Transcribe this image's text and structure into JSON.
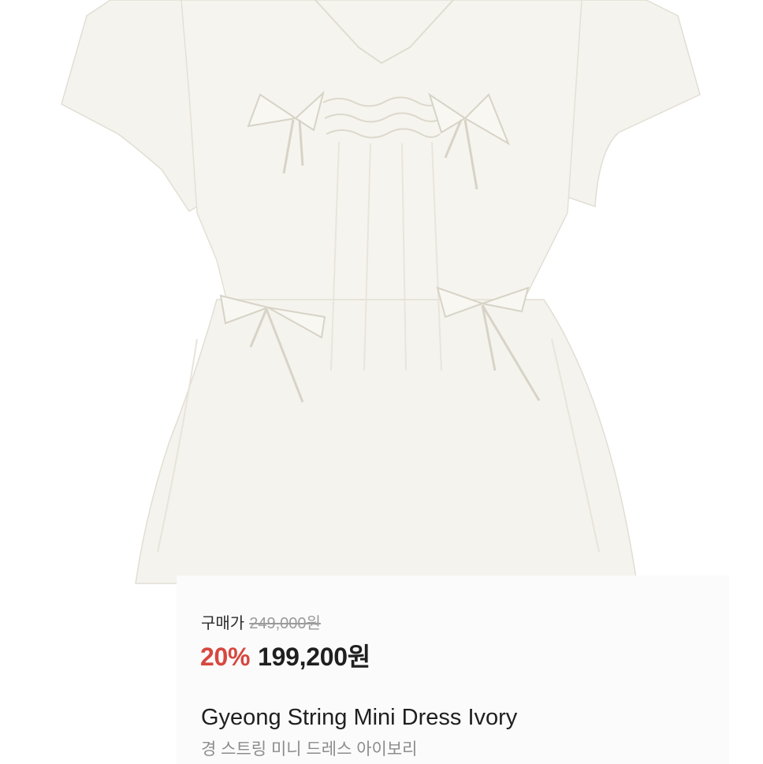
{
  "product_image": {
    "alt": "Gyeong String Mini Dress Ivory",
    "garment_color": "#f4f2ec",
    "shadow_color": "#e6e2d8"
  },
  "price": {
    "label": "구매가",
    "original": "249,000원",
    "discount": "20%",
    "sale": "199,200원"
  },
  "product": {
    "name_en": "Gyeong String Mini Dress Ivory",
    "name_ko": "경 스트링 미니 드레스 아이보리"
  },
  "colors": {
    "discount": "#d6483f",
    "card_background": "#fbfbfb",
    "secondary_text": "#8c8c8c"
  }
}
